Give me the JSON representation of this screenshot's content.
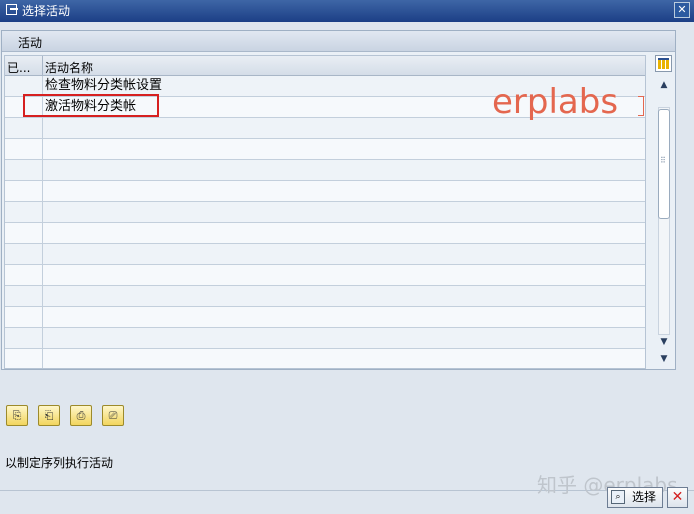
{
  "window": {
    "title": "选择活动"
  },
  "panel": {
    "title": "活动"
  },
  "table": {
    "columns": [
      "已...",
      "活动名称"
    ],
    "rows": [
      {
        "done": "",
        "name": "检查物料分类帐设置"
      },
      {
        "done": "",
        "name": "激活物料分类帐"
      },
      {
        "done": "",
        "name": ""
      },
      {
        "done": "",
        "name": ""
      },
      {
        "done": "",
        "name": ""
      },
      {
        "done": "",
        "name": ""
      },
      {
        "done": "",
        "name": ""
      },
      {
        "done": "",
        "name": ""
      },
      {
        "done": "",
        "name": ""
      },
      {
        "done": "",
        "name": ""
      },
      {
        "done": "",
        "name": ""
      },
      {
        "done": "",
        "name": ""
      },
      {
        "done": "",
        "name": ""
      },
      {
        "done": "",
        "name": ""
      }
    ]
  },
  "annotation": {
    "watermark": "erplabs"
  },
  "status_text": "以制定序列执行活动",
  "footer": {
    "watermark": "知乎 @erplabs",
    "select_label": "选择"
  },
  "icons": {
    "title": "dialog-icon",
    "close": "close-icon",
    "settings": "table-settings-icon",
    "select": "magnifier-icon",
    "cancel": "cancel-x-icon"
  },
  "colors": {
    "highlight": "#d62020",
    "watermark": "#e4674f",
    "titlebar": "#2c4f92"
  }
}
